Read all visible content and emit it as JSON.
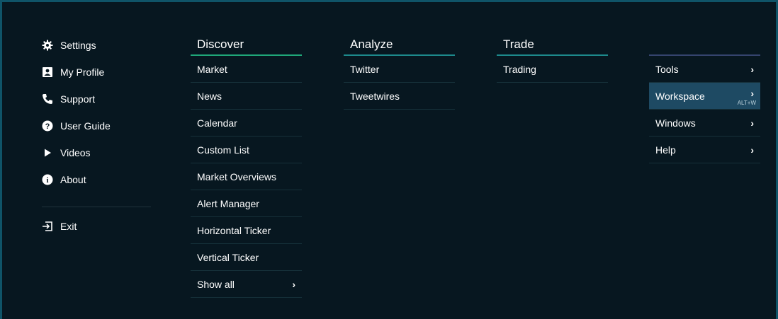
{
  "utility": {
    "items": [
      {
        "label": "Settings",
        "icon": "gear-icon"
      },
      {
        "label": "My Profile",
        "icon": "profile-card-icon"
      },
      {
        "label": "Support",
        "icon": "phone-icon"
      },
      {
        "label": "User Guide",
        "icon": "question-circle-icon"
      },
      {
        "label": "Videos",
        "icon": "play-icon"
      },
      {
        "label": "About",
        "icon": "info-circle-icon"
      }
    ],
    "exit_label": "Exit"
  },
  "columns": {
    "discover": {
      "title": "Discover",
      "items": [
        "Market",
        "News",
        "Calendar",
        "Custom List",
        "Market Overviews",
        "Alert Manager",
        "Horizontal Ticker",
        "Vertical Ticker",
        "Show all"
      ]
    },
    "analyze": {
      "title": "Analyze",
      "items": [
        "Twitter",
        "Tweetwires"
      ]
    },
    "trade": {
      "title": "Trade",
      "items": [
        "Trading"
      ]
    },
    "more": {
      "items": [
        {
          "label": "Tools"
        },
        {
          "label": "Workspace",
          "shortcut": "ALT+W"
        },
        {
          "label": "Windows"
        },
        {
          "label": "Help"
        }
      ]
    }
  },
  "colors": {
    "background": "#071720",
    "accent_green": "#1fa779",
    "accent_teal": "#1d8a8c",
    "active_item": "#1e4a63"
  }
}
